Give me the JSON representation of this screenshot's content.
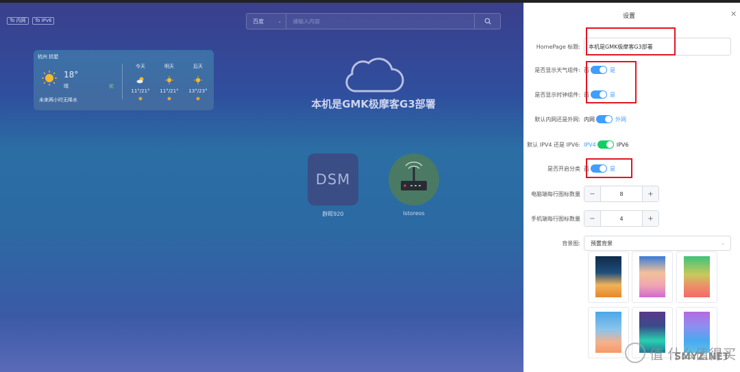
{
  "desktop": {
    "net_buttons": [
      "To 内网",
      "To IPv6"
    ],
    "search": {
      "engine": "百度",
      "placeholder": "请输入内容"
    },
    "weather": {
      "city": "杭州 拱墅",
      "temp": "18°",
      "condition": "晴",
      "aqi": "优",
      "tip": "未来两小时无降水",
      "days": [
        {
          "label": "今天",
          "range": "11°/21°"
        },
        {
          "label": "明天",
          "range": "11°/21°"
        },
        {
          "label": "后天",
          "range": "13°/23°"
        }
      ]
    },
    "title": "本机是GMK极摩客G3部署",
    "apps": [
      {
        "name": "群晖920",
        "tile_text": "DSM"
      },
      {
        "name": "Istoreos"
      }
    ]
  },
  "settings": {
    "title": "设置",
    "homepage_title_label": "HomePage 标题:",
    "homepage_title_value": "本机是GMK极摩客G3部署",
    "show_weather": {
      "label": "是否显示天气组件:",
      "off": "否",
      "on": "是",
      "enabled": true
    },
    "show_clock": {
      "label": "是否显示时钟组件:",
      "off": "否",
      "on": "是",
      "enabled": true
    },
    "network_mode": {
      "label": "默认内网还是外网:",
      "off": "内网",
      "on": "外网",
      "enabled": true
    },
    "ip_mode": {
      "label": "默认 IPV4 还是 IPV6:",
      "off": "IPV4",
      "on": "IPV6",
      "enabled": true
    },
    "categories": {
      "label": "是否开启分类",
      "off": "否",
      "on": "是",
      "enabled": true
    },
    "desktop_icons": {
      "label": "电脑端每行图标数量",
      "value": "8",
      "minus": "−",
      "plus": "+"
    },
    "mobile_icons": {
      "label": "手机端每行图标数量",
      "value": "4",
      "minus": "−",
      "plus": "+"
    },
    "background": {
      "label": "背景图:",
      "selected": "预置背景"
    }
  },
  "watermark": {
    "text1": "值 什么值得买",
    "text2": "SMYZ.NET"
  },
  "colors": {
    "accent": "#409eff",
    "green": "#13ce66",
    "highlight": "#e0141e"
  }
}
